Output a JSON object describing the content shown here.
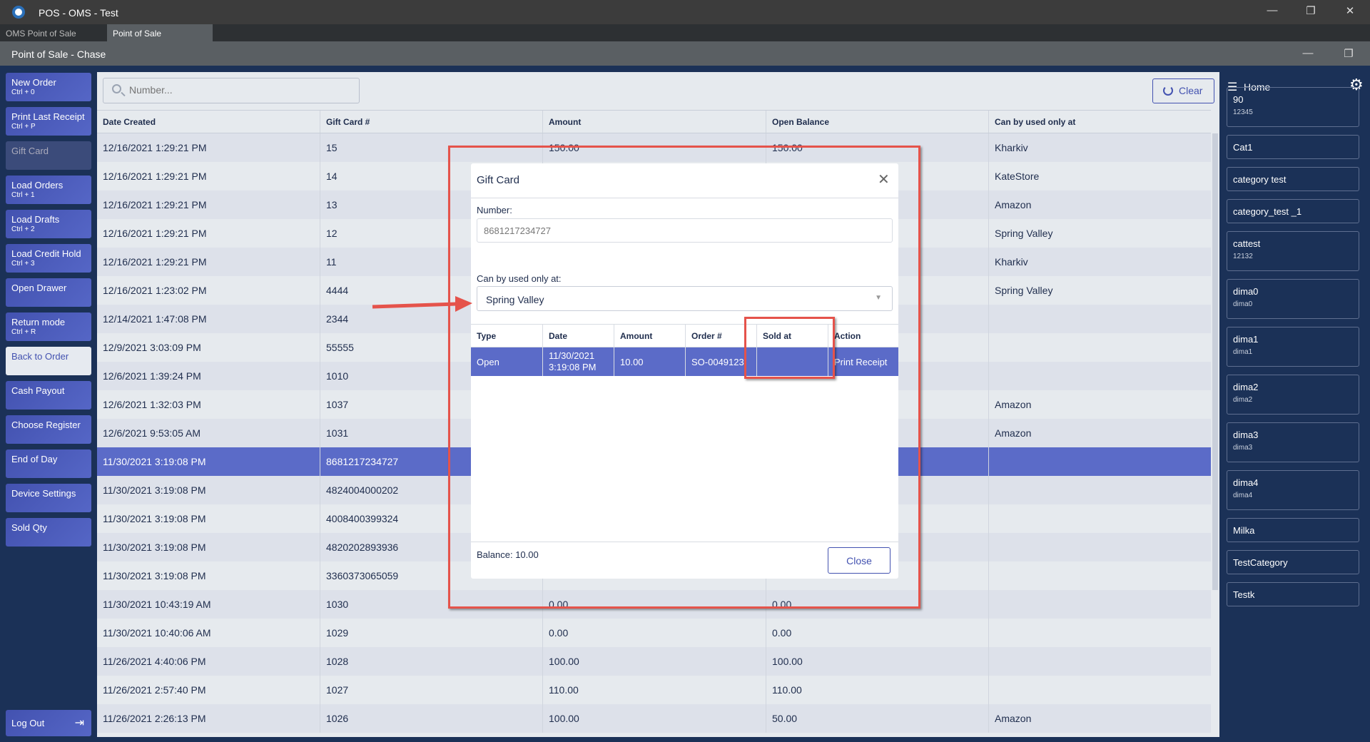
{
  "window": {
    "title": "POS - OMS - Test",
    "min": "—",
    "restore": "❐",
    "close": "✕"
  },
  "tabs": [
    "OMS Point of Sale",
    "Point of Sale"
  ],
  "subheader": {
    "title": "Point of Sale - Chase",
    "min": "—",
    "restore": "❐"
  },
  "left_menu": [
    {
      "label": "New Order",
      "shortcut": "Ctrl + 0"
    },
    {
      "label": "Print Last Receipt",
      "shortcut": "Ctrl + P"
    },
    {
      "label": "Gift Card",
      "shortcut": ""
    },
    {
      "label": "Load Orders",
      "shortcut": "Ctrl + 1"
    },
    {
      "label": "Load Drafts",
      "shortcut": "Ctrl + 2"
    },
    {
      "label": "Load Credit Hold",
      "shortcut": "Ctrl + 3"
    },
    {
      "label": "Open Drawer",
      "shortcut": ""
    },
    {
      "label": "Return mode",
      "shortcut": "Ctrl + R"
    },
    {
      "label": "Back to Order",
      "shortcut": ""
    },
    {
      "label": "Cash Payout",
      "shortcut": ""
    },
    {
      "label": "Choose Register",
      "shortcut": ""
    },
    {
      "label": "End of Day",
      "shortcut": ""
    },
    {
      "label": "Device Settings",
      "shortcut": ""
    },
    {
      "label": "Sold Qty",
      "shortcut": ""
    }
  ],
  "logout": "Log Out",
  "search": {
    "placeholder": "Number..."
  },
  "clear_label": "Clear",
  "table": {
    "headers": [
      "Date Created",
      "Gift Card #",
      "Amount",
      "Open Balance",
      "Can by used only at"
    ],
    "rows": [
      [
        "12/16/2021 1:29:21 PM",
        "15",
        "150.00",
        "150.00",
        "Kharkiv"
      ],
      [
        "12/16/2021 1:29:21 PM",
        "14",
        "",
        "",
        "KateStore"
      ],
      [
        "12/16/2021 1:29:21 PM",
        "13",
        "",
        "",
        "Amazon"
      ],
      [
        "12/16/2021 1:29:21 PM",
        "12",
        "",
        "",
        "Spring Valley"
      ],
      [
        "12/16/2021 1:29:21 PM",
        "11",
        "",
        "",
        "Kharkiv"
      ],
      [
        "12/16/2021 1:23:02 PM",
        "4444",
        "",
        "",
        "Spring Valley"
      ],
      [
        "12/14/2021 1:47:08 PM",
        "2344",
        "",
        "",
        ""
      ],
      [
        "12/9/2021 3:03:09 PM",
        "55555",
        "",
        "",
        ""
      ],
      [
        "12/6/2021 1:39:24 PM",
        "1010",
        "",
        "",
        ""
      ],
      [
        "12/6/2021 1:32:03 PM",
        "1037",
        "",
        "",
        "Amazon"
      ],
      [
        "12/6/2021 9:53:05 AM",
        "1031",
        "",
        "",
        "Amazon"
      ],
      [
        "11/30/2021 3:19:08 PM",
        "8681217234727",
        "",
        "",
        ""
      ],
      [
        "11/30/2021 3:19:08 PM",
        "4824004000202",
        "",
        "",
        ""
      ],
      [
        "11/30/2021 3:19:08 PM",
        "4008400399324",
        "",
        "",
        ""
      ],
      [
        "11/30/2021 3:19:08 PM",
        "4820202893936",
        "",
        "",
        ""
      ],
      [
        "11/30/2021 3:19:08 PM",
        "3360373065059",
        "",
        "",
        ""
      ],
      [
        "11/30/2021 10:43:19 AM",
        "1030",
        "0.00",
        "0.00",
        ""
      ],
      [
        "11/30/2021 10:40:06 AM",
        "1029",
        "0.00",
        "0.00",
        ""
      ],
      [
        "11/26/2021 4:40:06 PM",
        "1028",
        "100.00",
        "100.00",
        ""
      ],
      [
        "11/26/2021 2:57:40 PM",
        "1027",
        "110.00",
        "110.00",
        ""
      ],
      [
        "11/26/2021 2:26:13 PM",
        "1026",
        "100.00",
        "50.00",
        "Amazon"
      ]
    ],
    "selected_index": 11
  },
  "right_panel": {
    "home": "Home",
    "categories": [
      {
        "name": "90",
        "sub": "12345"
      },
      {
        "name": "Cat1",
        "sub": ""
      },
      {
        "name": "category test",
        "sub": ""
      },
      {
        "name": "category_test _1",
        "sub": ""
      },
      {
        "name": "cattest",
        "sub": "12132"
      },
      {
        "name": "dima0",
        "sub": "dima0"
      },
      {
        "name": "dima1",
        "sub": "dima1"
      },
      {
        "name": "dima2",
        "sub": "dima2"
      },
      {
        "name": "dima3",
        "sub": "dima3"
      },
      {
        "name": "dima4",
        "sub": "dima4"
      },
      {
        "name": "Milka",
        "sub": ""
      },
      {
        "name": "TestCategory",
        "sub": ""
      },
      {
        "name": "Testk",
        "sub": ""
      }
    ]
  },
  "modal": {
    "title": "Gift Card",
    "number_label": "Number:",
    "number_value": "8681217234727",
    "location_label": "Can by used only at:",
    "location_value": "Spring Valley",
    "headers": [
      "Type",
      "Date",
      "Amount",
      "Order #",
      "Sold at",
      "Action"
    ],
    "row": [
      "Open",
      "11/30/2021\n3:19:08 PM",
      "10.00",
      "SO-0049123",
      "",
      "Print Receipt"
    ],
    "balance": "Balance: 10.00",
    "close_label": "Close"
  },
  "colors": {
    "accent": "#4352b0",
    "selected": "#5b6bc8",
    "sidebar": "#1b3157",
    "annotation": "#e5534b"
  }
}
